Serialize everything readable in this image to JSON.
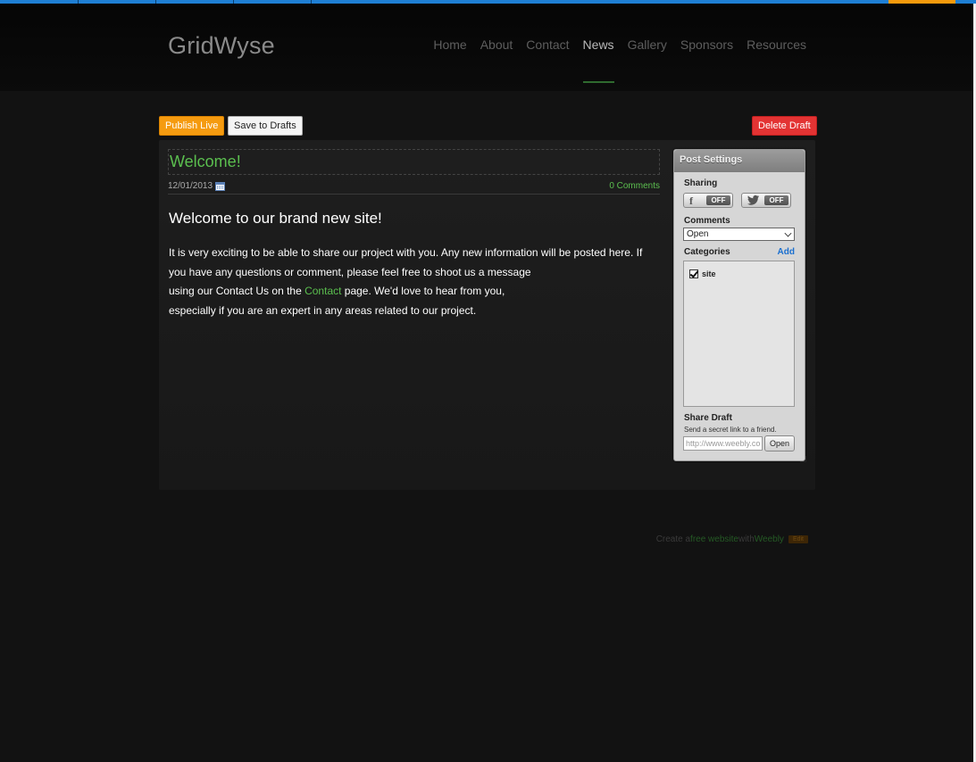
{
  "site": {
    "title": "GridWyse",
    "nav": [
      "Home",
      "About",
      "Contact",
      "News",
      "Gallery",
      "Sponsors",
      "Resources"
    ],
    "active_nav": "News"
  },
  "toolbar": {
    "publish_label": "Publish Live",
    "save_label": "Save to Drafts",
    "delete_label": "Delete Draft"
  },
  "post": {
    "title": "Welcome!",
    "date": "12/01/2013",
    "comments": "0 Comments",
    "heading": "Welcome to our brand new site!",
    "body_line1": "It is very exciting to be able to share our project with you. Any new information will be posted here. If you have any questions or comment, please feel free to shoot us a message",
    "body_line2_pre": "using our Contact Us on the ",
    "body_link": "Contact",
    "body_line2_post": " page. We'd love to hear from you,",
    "body_line3": "especially if you are an expert in any areas related to our project."
  },
  "settings": {
    "header": "Post Settings",
    "sharing_label": "Sharing",
    "facebook_toggle": "OFF",
    "twitter_toggle": "OFF",
    "comments_label": "Comments",
    "comments_value": "Open",
    "categories_label": "Categories",
    "add_label": "Add",
    "categories": [
      {
        "name": "site",
        "checked": true
      }
    ],
    "share_label": "Share Draft",
    "share_sub": "Send a secret link to a friend.",
    "share_url": "http://www.weebly.co",
    "open_label": "Open"
  },
  "footer": {
    "pre": "Create a ",
    "link1": "free website",
    "mid": " with ",
    "link2": "Weebly",
    "edit": "Edit"
  },
  "colors": {
    "accent_green": "#5bbf4f",
    "publish_orange": "#f59b10",
    "delete_red": "#e33333",
    "editor_blue": "#1f7fd4"
  },
  "icons": [
    "facebook-icon",
    "twitter-icon",
    "calendar-icon",
    "chevron-down-icon",
    "checkbox-icon",
    "resize-icon"
  ]
}
